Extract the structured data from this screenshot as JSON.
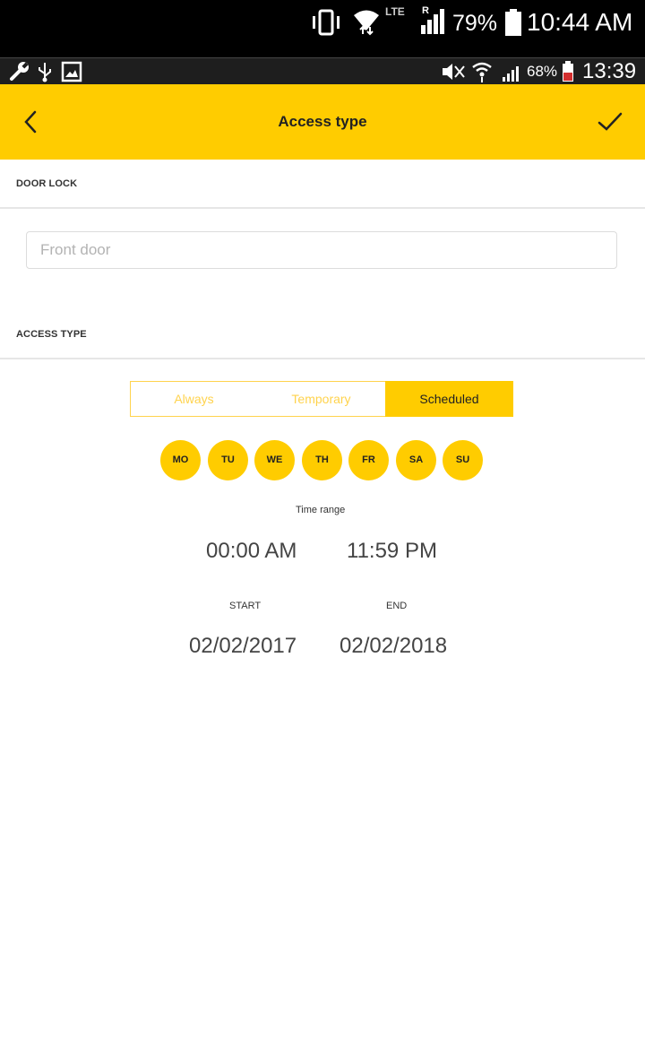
{
  "outer_status": {
    "battery": "79%",
    "time": "10:44 AM",
    "roaming": "R",
    "lte": "LTE"
  },
  "inner_status": {
    "battery": "68%",
    "time": "13:39"
  },
  "header": {
    "title": "Access type"
  },
  "door_lock": {
    "label": "DOOR LOCK",
    "input_placeholder": "Front door"
  },
  "access_type": {
    "label": "ACCESS TYPE",
    "options": [
      "Always",
      "Temporary",
      "Scheduled"
    ],
    "selected": "Scheduled"
  },
  "days": [
    "MO",
    "TU",
    "WE",
    "TH",
    "FR",
    "SA",
    "SU"
  ],
  "time_range": {
    "label": "Time range",
    "start": "00:00 AM",
    "end": "11:59 PM"
  },
  "date_range": {
    "start_label": "START",
    "end_label": "END",
    "start": "02/02/2017",
    "end": "02/02/2018"
  },
  "colors": {
    "accent": "#ffcc00",
    "accent_light": "#ffd34d"
  }
}
